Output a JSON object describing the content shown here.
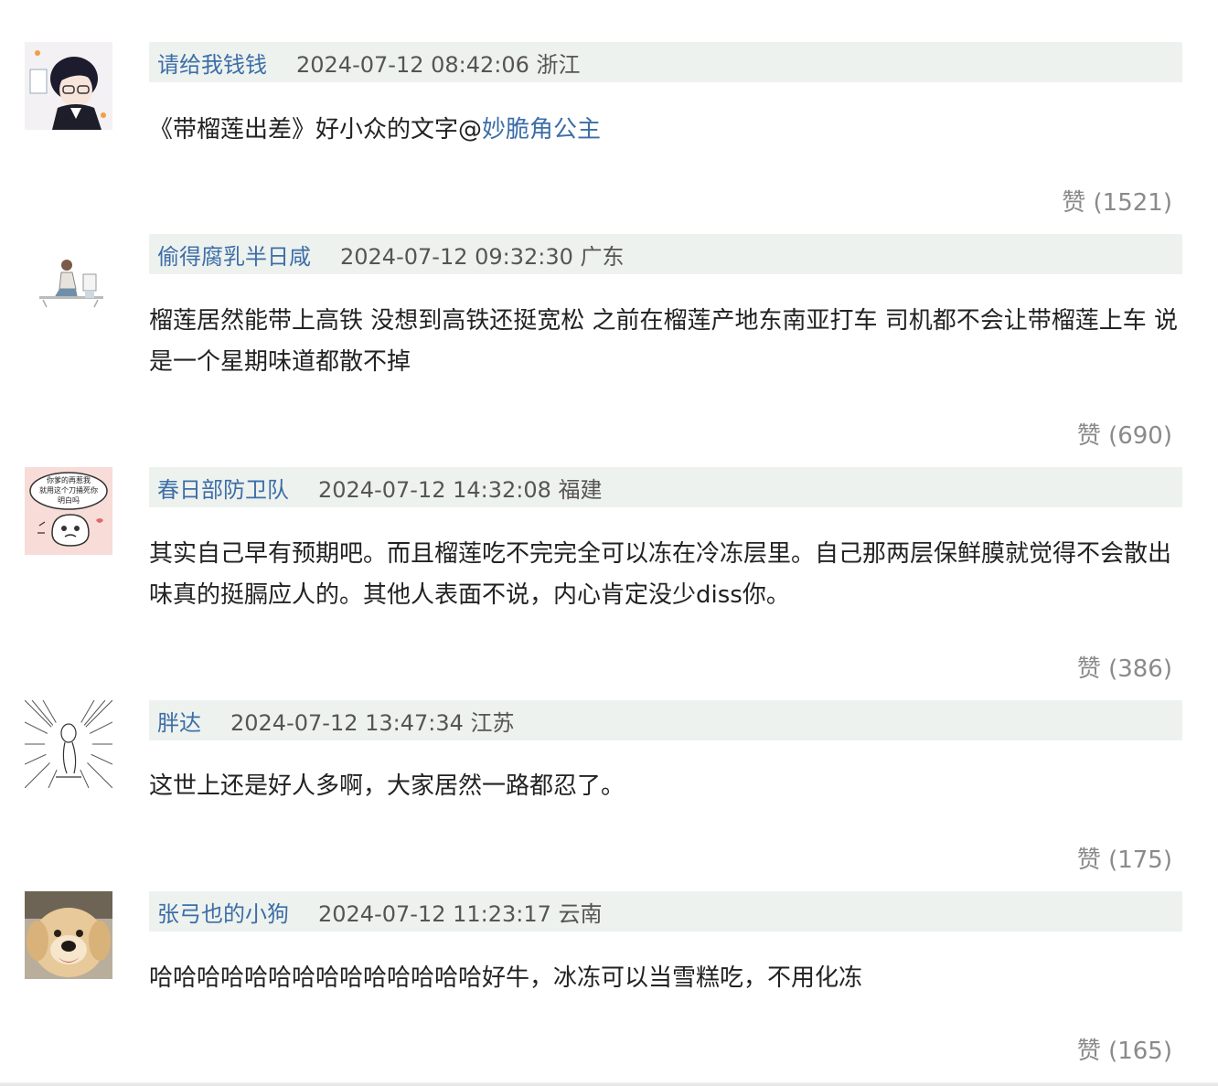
{
  "comments": [
    {
      "avatar": "anime-boy-avatar",
      "username": "请给我钱钱",
      "meta": "2024-07-12 08:42:06 浙江",
      "text": "《带榴莲出差》好小众的文字@",
      "mention": "妙脆角公主",
      "likes": "赞 (1521)"
    },
    {
      "avatar": "sketch-person-avatar",
      "username": "偷得腐乳半日咸",
      "meta": "2024-07-12 09:32:30 广东",
      "text": "榴莲居然能带上高铁 没想到高铁还挺宽松 之前在榴莲产地东南亚打车 司机都不会让带榴莲上车 说是一个星期味道都散不掉",
      "likes": "赞 (690)"
    },
    {
      "avatar": "sticker-meme-avatar",
      "avatar_text": "你爹的再惹我 就用这个刀捅死你 明白吗",
      "username": "春日部防卫队",
      "meta": "2024-07-12 14:32:08 福建",
      "text": "其实自己早有预期吧。而且榴莲吃不完完全可以冻在冷冻层里。自己那两层保鲜膜就觉得不会散出味真的挺膈应人的。其他人表面不说，内心肯定没少diss你。",
      "likes": "赞 (386)"
    },
    {
      "avatar": "speedline-sketch-avatar",
      "username": "胖达",
      "meta": "2024-07-12 13:47:34 江苏",
      "text": "这世上还是好人多啊，大家居然一路都忍了。",
      "likes": "赞 (175)"
    },
    {
      "avatar": "golden-retriever-avatar",
      "username": "张弓也的小狗",
      "meta": "2024-07-12 11:23:17 云南",
      "text": "哈哈哈哈哈哈哈哈哈哈哈哈哈哈好牛，冰冻可以当雪糕吃，不用化冻",
      "likes": "赞 (165)"
    }
  ],
  "colors": {
    "username": "#3c6ea8",
    "header_bg": "#eef2ee",
    "likes": "#8a8a8a"
  }
}
